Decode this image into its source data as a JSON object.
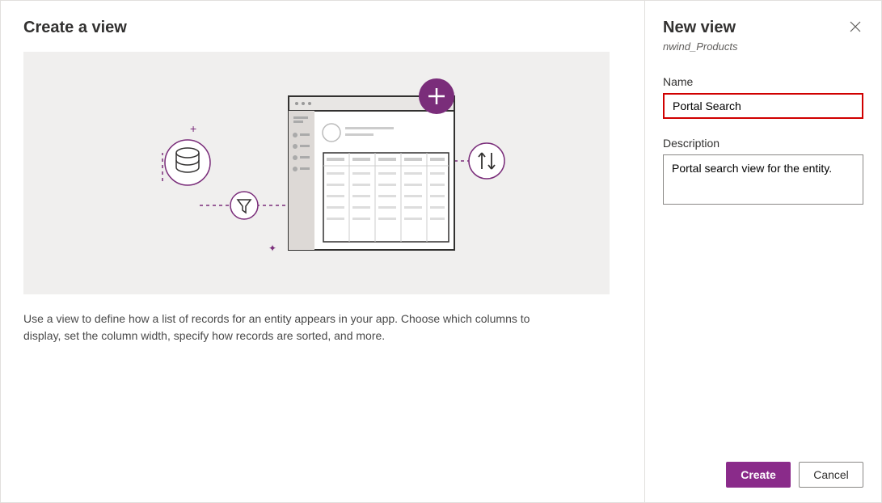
{
  "left": {
    "title": "Create a view",
    "description": "Use a view to define how a list of records for an entity appears in your app. Choose which columns to display, set the column width, specify how records are sorted, and more."
  },
  "right": {
    "title": "New view",
    "subtitle": "nwind_Products",
    "name_label": "Name",
    "name_value": "Portal Search",
    "desc_label": "Description",
    "desc_value": "Portal search view for the entity."
  },
  "footer": {
    "create_label": "Create",
    "cancel_label": "Cancel"
  }
}
